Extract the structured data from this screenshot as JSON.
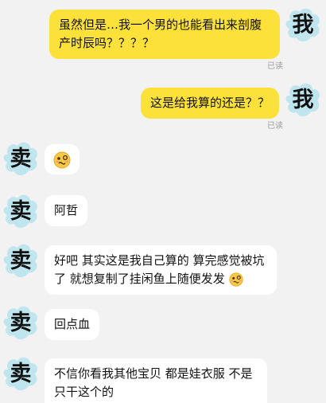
{
  "avatars": {
    "me": "我",
    "seller": "卖"
  },
  "colors": {
    "background": "#f2f2f2",
    "outgoing_bubble": "#fde13b",
    "incoming_bubble": "#ffffff",
    "avatar_cloud": "#bfe6ef",
    "read_label": "#9a9a9a"
  },
  "messages": [
    {
      "side": "out",
      "text": "虽然但是…我一个男的也能看出来剖腹产时辰吗？？？？",
      "status": "已读"
    },
    {
      "side": "out",
      "text": "这是给我算的还是？？",
      "status": "已读"
    },
    {
      "side": "in",
      "text": "",
      "emoji": "woozy-face-icon"
    },
    {
      "side": "in",
      "text": "阿哲"
    },
    {
      "side": "in",
      "text": "好吧 其实这是我自己算的 算完感觉被坑了 就想复制了挂闲鱼上随便发发",
      "emoji": "woozy-face-icon"
    },
    {
      "side": "in",
      "text": "回点血"
    },
    {
      "side": "in",
      "text": "不信你看我其他宝贝 都是娃衣服 不是只干这个的"
    }
  ]
}
